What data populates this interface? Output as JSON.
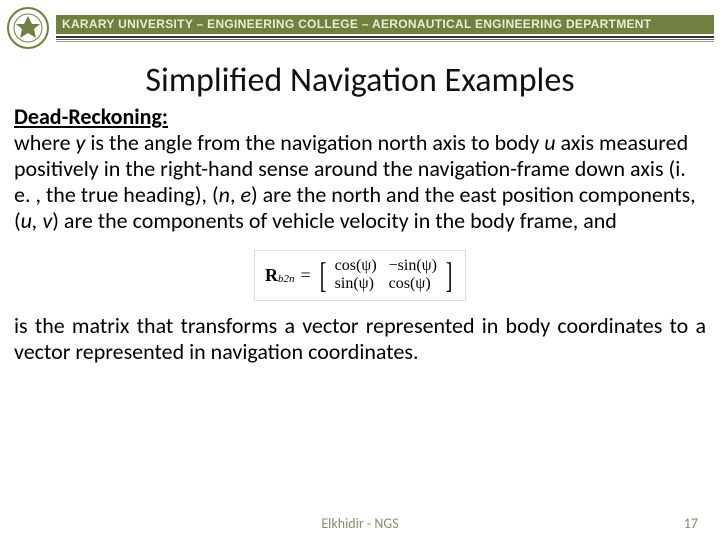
{
  "header": {
    "banner": "KARARY UNIVERSITY – ENGINEERING COLLEGE – AERONAUTICAL ENGINEERING DEPARTMENT"
  },
  "title": "Simplified Navigation Examples",
  "subheading": "Dead-Reckoning:",
  "para1_a": "where ",
  "para1_y": "y",
  "para1_b": " is the angle from the navigation north axis to body ",
  "para1_u": "u",
  "para1_c": " axis measured positively in the right-hand sense around the navigation-frame down axis (i. e. , the true heading), (",
  "para1_n": "n",
  "para1_comma1": ", ",
  "para1_e": "e",
  "para1_d": ") are the north and the east position components, (",
  "para1_u2": "u, v",
  "para1_f": ") are the components of vehicle velocity in the body frame, and",
  "matrix": {
    "lhs_bold": "R",
    "lhs_sub": "b2n",
    "eq": "=",
    "r1c1": "cos(ψ)",
    "r1c2": "−sin(ψ)",
    "r2c1": "sin(ψ)",
    "r2c2": "cos(ψ)"
  },
  "para2": "is the matrix that transforms a vector represented in body coordinates to a vector represented in navigation coordinates.",
  "footer": {
    "center": "Elkhidir - NGS",
    "page": "17"
  }
}
